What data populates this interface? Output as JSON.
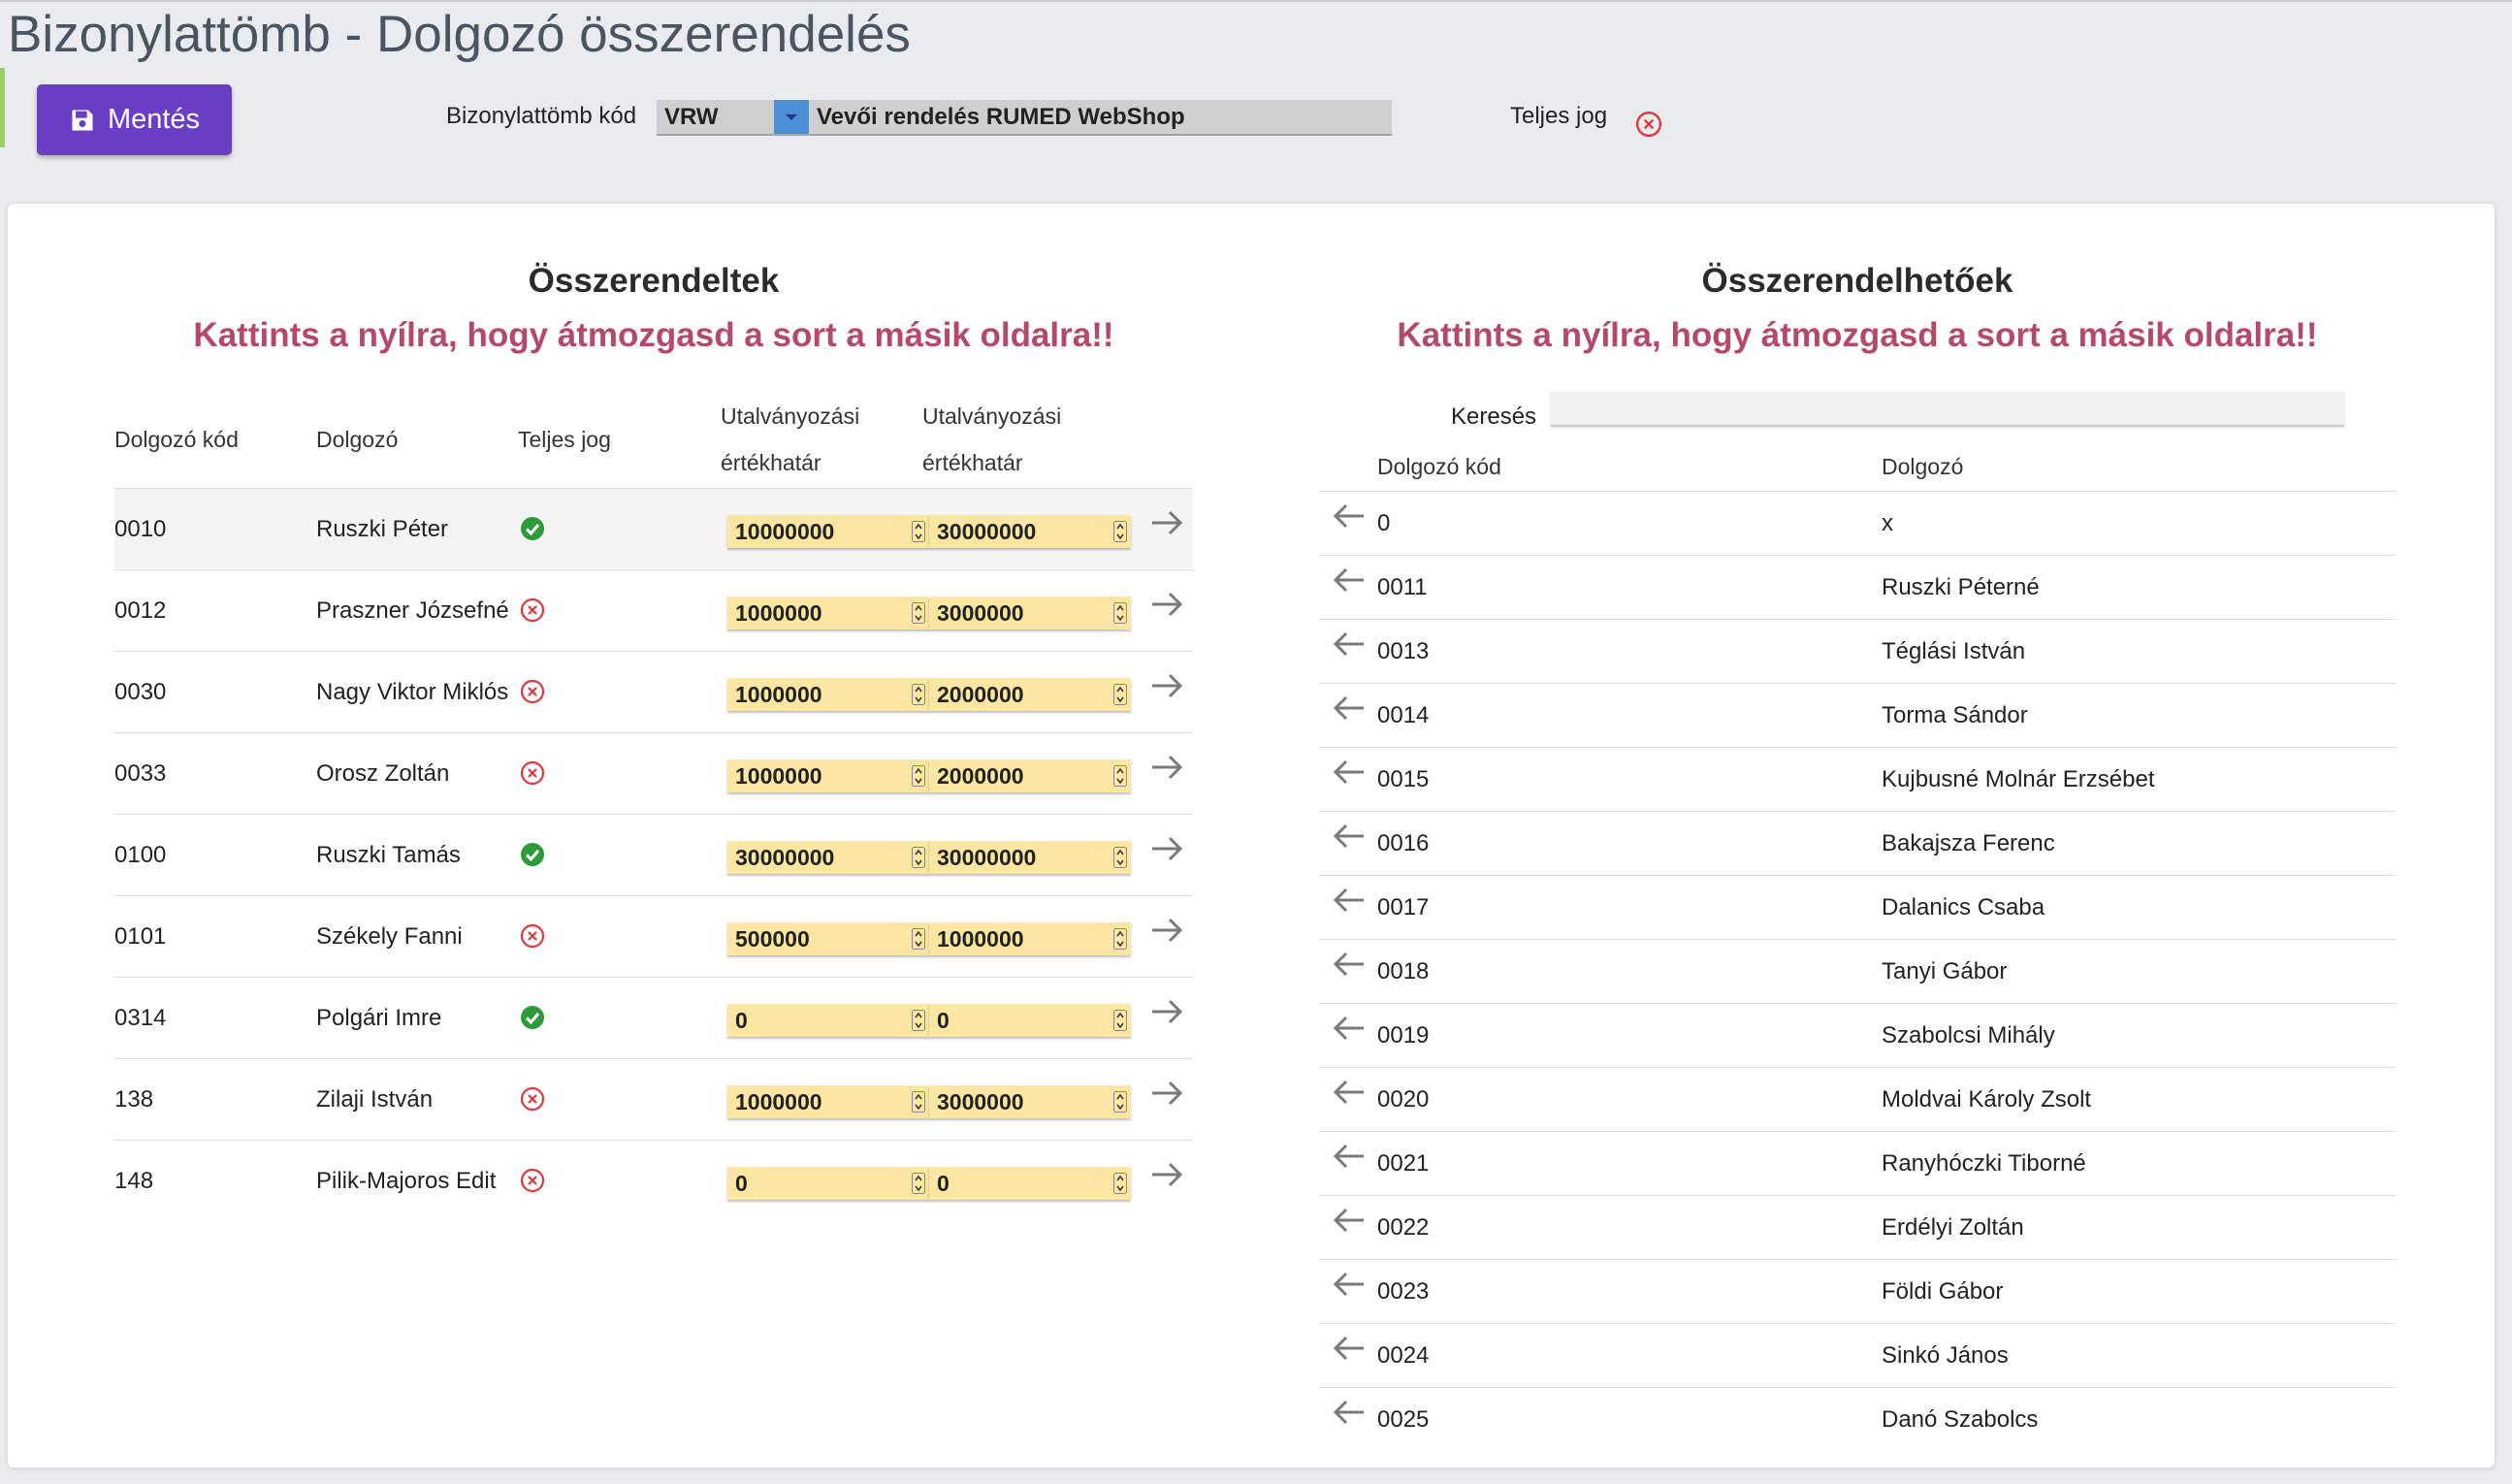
{
  "title": "Bizonylattömb - Dolgozó összerendelés",
  "toolbar": {
    "save_label": "Mentés",
    "code_label": "Bizonylattömb kód",
    "code_value": "VRW",
    "code_desc": "Vevői rendelés RUMED WebShop",
    "full_right_label": "Teljes jog"
  },
  "left": {
    "title": "Összerendeltek",
    "hint": "Kattints a nyílra, hogy átmozgasd a sort a másik oldalra!!",
    "headers": {
      "code": "Dolgozó kód",
      "name": "Dolgozó",
      "full": "Teljes jog",
      "limit1_a": "Utalványozási",
      "limit1_b": "értékhatár",
      "limit2_a": "Utalványozási",
      "limit2_b": "értékhatár"
    },
    "rows": [
      {
        "code": "0010",
        "name": "Ruszki Péter",
        "full": true,
        "v1": "10000000",
        "v2": "30000000"
      },
      {
        "code": "0012",
        "name": "Praszner Józsefné",
        "full": false,
        "v1": "1000000",
        "v2": "3000000"
      },
      {
        "code": "0030",
        "name": "Nagy Viktor Miklós",
        "full": false,
        "v1": "1000000",
        "v2": "2000000"
      },
      {
        "code": "0033",
        "name": "Orosz Zoltán",
        "full": false,
        "v1": "1000000",
        "v2": "2000000"
      },
      {
        "code": "0100",
        "name": "Ruszki Tamás",
        "full": true,
        "v1": "30000000",
        "v2": "30000000"
      },
      {
        "code": "0101",
        "name": "Székely Fanni",
        "full": false,
        "v1": "500000",
        "v2": "1000000"
      },
      {
        "code": "0314",
        "name": "Polgári Imre",
        "full": true,
        "v1": "0",
        "v2": "0"
      },
      {
        "code": "138",
        "name": "Zilaji István",
        "full": false,
        "v1": "1000000",
        "v2": "3000000"
      },
      {
        "code": "148",
        "name": "Pilik-Majoros Edit",
        "full": false,
        "v1": "0",
        "v2": "0"
      }
    ]
  },
  "right": {
    "title": "Összerendelhetőek",
    "hint": "Kattints a nyílra, hogy átmozgasd a sort a másik oldalra!!",
    "search_label": "Keresés",
    "search_value": "",
    "headers": {
      "code": "Dolgozó kód",
      "name": "Dolgozó"
    },
    "rows": [
      {
        "code": "0",
        "name": "x"
      },
      {
        "code": "0011",
        "name": "Ruszki Péterné"
      },
      {
        "code": "0013",
        "name": "Téglási István"
      },
      {
        "code": "0014",
        "name": "Torma Sándor"
      },
      {
        "code": "0015",
        "name": "Kujbusné Molnár Erzsébet"
      },
      {
        "code": "0016",
        "name": "Bakajsza Ferenc"
      },
      {
        "code": "0017",
        "name": "Dalanics Csaba"
      },
      {
        "code": "0018",
        "name": "Tanyi Gábor"
      },
      {
        "code": "0019",
        "name": "Szabolcsi Mihály"
      },
      {
        "code": "0020",
        "name": "Moldvai Károly Zsolt"
      },
      {
        "code": "0021",
        "name": "Ranyhóczki Tiborné"
      },
      {
        "code": "0022",
        "name": "Erdélyi Zoltán"
      },
      {
        "code": "0023",
        "name": "Földi Gábor"
      },
      {
        "code": "0024",
        "name": "Sinkó János"
      },
      {
        "code": "0025",
        "name": "Danó Szabolcs"
      }
    ]
  },
  "colors": {
    "accent": "#6a3fc6",
    "hint": "#b44a6a",
    "ok": "#2e9b3a",
    "no": "#e0363c",
    "field": "#fbe7a1"
  },
  "icons": {
    "save": "floppy-icon",
    "ok": "check-circle-icon",
    "no": "x-circle-icon",
    "move_right": "arrow-right-icon",
    "move_left": "arrow-left-icon"
  }
}
